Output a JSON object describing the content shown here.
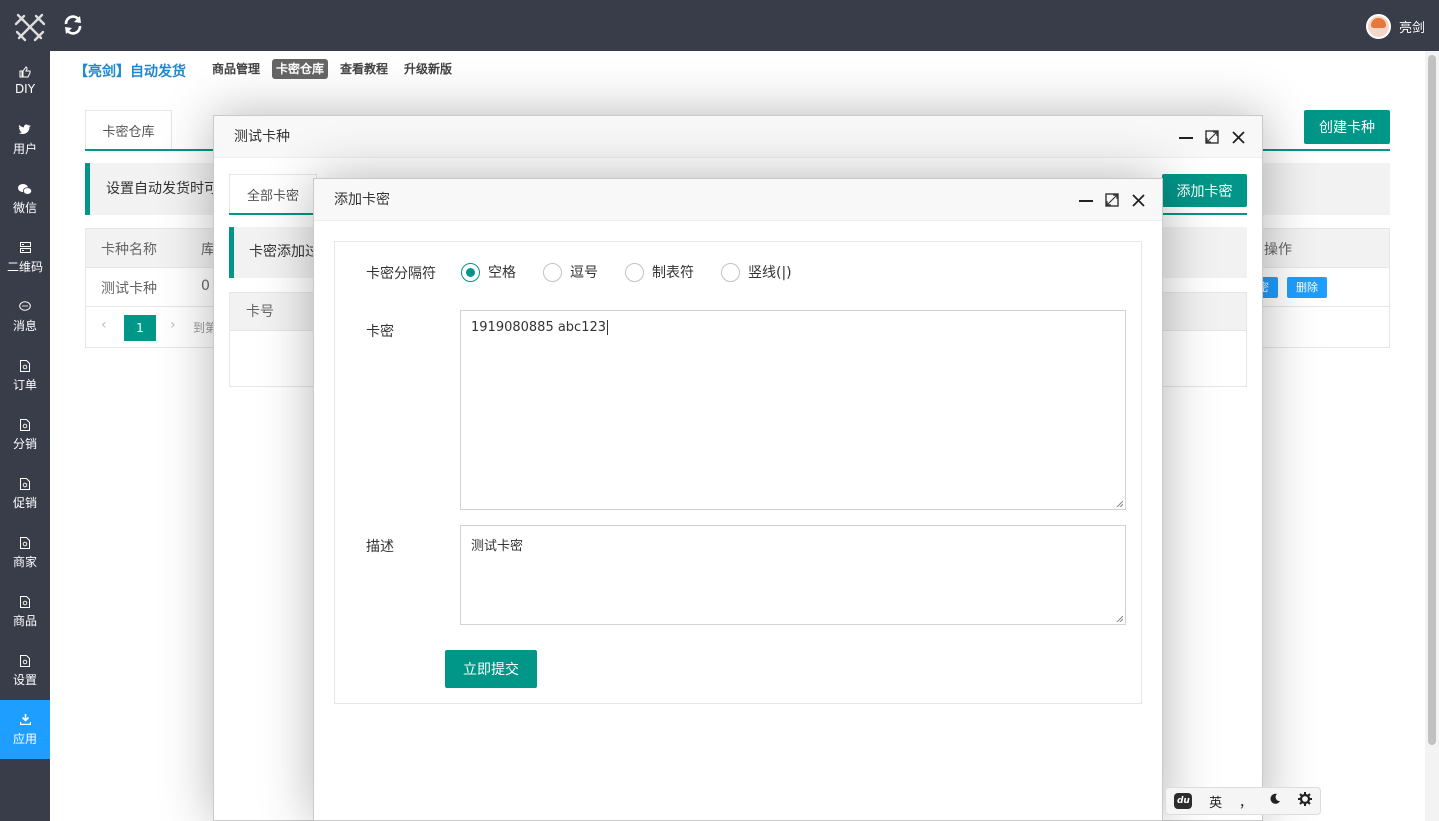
{
  "topbar": {
    "user_name": "亮剑"
  },
  "sidebar": {
    "items": [
      {
        "label": "DIY",
        "icon": "thumbs-up-icon"
      },
      {
        "label": "用户",
        "icon": "twitter-icon"
      },
      {
        "label": "微信",
        "icon": "wechat-icon"
      },
      {
        "label": "二维码",
        "icon": "qrcode-icon"
      },
      {
        "label": "消息",
        "icon": "message-icon"
      },
      {
        "label": "订单",
        "icon": "file-icon"
      },
      {
        "label": "分销",
        "icon": "file-icon"
      },
      {
        "label": "促销",
        "icon": "file-icon"
      },
      {
        "label": "商家",
        "icon": "file-icon"
      },
      {
        "label": "商品",
        "icon": "file-icon"
      },
      {
        "label": "设置",
        "icon": "file-icon"
      },
      {
        "label": "应用",
        "icon": "download-icon"
      }
    ],
    "active_index": 11,
    "active_color": "#1e9fff"
  },
  "header": {
    "brand": "【亮剑】自动发货",
    "nav": [
      "商品管理",
      "卡密仓库",
      "查看教程",
      "升级新版"
    ],
    "active_nav": "卡密仓库"
  },
  "background_page": {
    "tab": "卡密仓库",
    "create_button": "创建卡种",
    "notice": "设置自动发货时可",
    "table": {
      "headers": [
        "卡种名称",
        "库",
        "操作"
      ],
      "rows": [
        {
          "name": "测试卡种",
          "stock": "0",
          "btn1": "密",
          "btn2": "删除"
        }
      ]
    },
    "pager": {
      "current": "1",
      "goto": "到第"
    }
  },
  "modal_outer": {
    "title": "测试卡种",
    "tab": "全部卡密",
    "add_button": "添加卡密",
    "notice": "卡密添加过",
    "table_header": "卡号"
  },
  "modal_inner": {
    "title": "添加卡密",
    "separator_label": "卡密分隔符",
    "separators": [
      "空格",
      "逗号",
      "制表符",
      "竖线(|)"
    ],
    "selected_separator": "空格",
    "card_label": "卡密",
    "card_value": "1919080885 abc123",
    "desc_label": "描述",
    "desc_value": "测试卡密",
    "submit": "立即提交"
  },
  "ime": {
    "mode": "英",
    "punct": "，"
  },
  "colors": {
    "primary": "#009688",
    "dark": "#393d49",
    "blue": "#1e9fff",
    "brand_blue": "#1e88d0"
  }
}
